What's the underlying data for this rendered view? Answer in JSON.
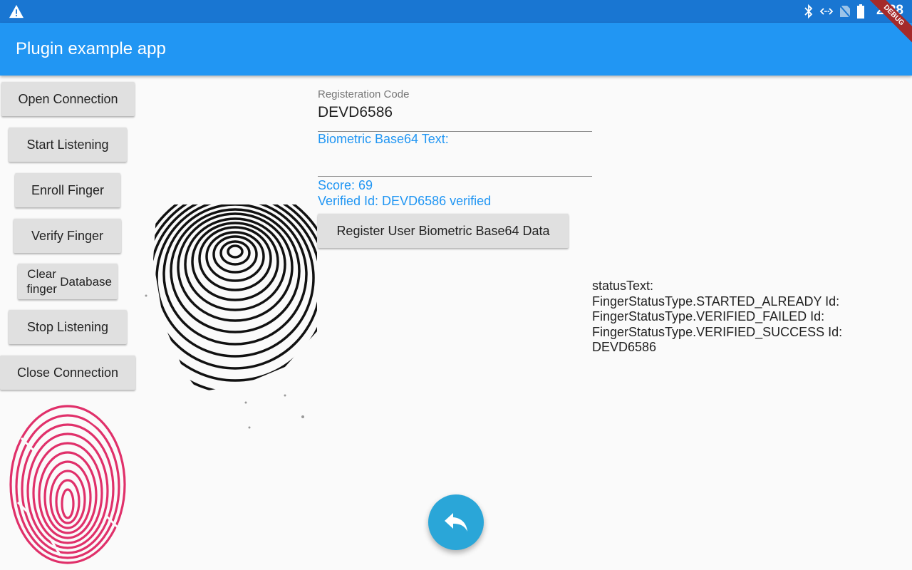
{
  "statusbar": {
    "warning_icon": "warning-triangle-icon",
    "icons": [
      "bluetooth-icon",
      "data-sync-icon",
      "no-sim-icon",
      "battery-icon"
    ],
    "clock": "2:38"
  },
  "debug_banner": "DEBUG",
  "appbar": {
    "title": "Plugin example app"
  },
  "buttons": {
    "open_connection": "Open Connection",
    "start_listening": "Start Listening",
    "enroll_finger": "Enroll Finger",
    "verify_finger": "Verify Finger",
    "clear_db_line1": "Clear finger",
    "clear_db_line2": "Database",
    "stop_listening": "Stop Listening",
    "close_connection": "Close Connection"
  },
  "form": {
    "registration_label": "Registeration Code",
    "registration_value": "DEVD6586",
    "biometric_label": "Biometric Base64 Text:",
    "score_text": "Score: 69",
    "verified_text": "Verified Id: DEVD6586 verified",
    "register_button": "Register User Biometric Base64 Data"
  },
  "status_lines": [
    "statusText:",
    "FingerStatusType.STARTED_ALREADY Id:",
    "FingerStatusType.VERIFIED_FAILED Id:",
    "FingerStatusType.VERIFIED_SUCCESS Id:",
    "DEVD6586"
  ],
  "fab": {
    "icon": "reply-icon"
  },
  "colors": {
    "appbar": "#2196f3",
    "statusbar": "#1976d2",
    "accent_text": "#2196f3",
    "fingerprint_pink": "#e0306a",
    "fab": "#2aa6d8"
  }
}
